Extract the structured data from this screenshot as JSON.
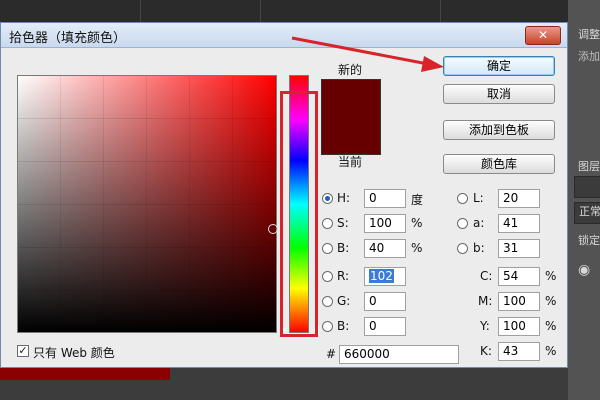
{
  "background": {
    "right_panel": {
      "label_adjust": "调整",
      "label_add": "添加",
      "label_layers": "图层",
      "label_normal": "正常",
      "label_lock": "锁定"
    }
  },
  "dialog": {
    "title": "拾色器（填充颜色）",
    "close_symbol": "✕",
    "new_label": "新的",
    "current_label": "当前",
    "new_color": "#660000",
    "current_color": "#660000",
    "buttons": {
      "ok": "确定",
      "cancel": "取消",
      "add_to_swatches": "添加到色板",
      "color_libraries": "颜色库"
    },
    "hsb": {
      "h_label": "H:",
      "h_value": "0",
      "h_unit": "度",
      "s_label": "S:",
      "s_value": "100",
      "s_unit": "%",
      "b_label": "B:",
      "b_value": "40",
      "b_unit": "%"
    },
    "rgb": {
      "r_label": "R:",
      "r_value": "102",
      "g_label": "G:",
      "g_value": "0",
      "b_label": "B:",
      "b_value": "0"
    },
    "lab": {
      "l_label": "L:",
      "l_value": "20",
      "a_label": "a:",
      "a_value": "41",
      "b_label": "b:",
      "b_value": "31"
    },
    "cmyk": {
      "c_label": "C:",
      "c_value": "54",
      "c_unit": "%",
      "m_label": "M:",
      "m_value": "100",
      "m_unit": "%",
      "y_label": "Y:",
      "y_value": "100",
      "y_unit": "%",
      "k_label": "K:",
      "k_value": "43",
      "k_unit": "%"
    },
    "hex_label": "#",
    "hex_value": "660000",
    "web_only_label": "只有 Web 颜色",
    "web_only_checked": true,
    "check_symbol": "✓",
    "selected_radio": "H",
    "annotation_color": "#d9232a"
  }
}
